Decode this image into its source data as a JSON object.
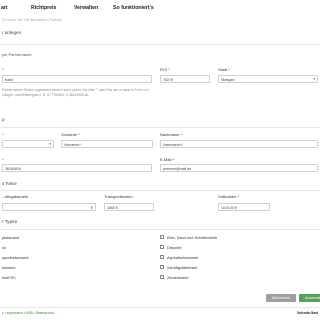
{
  "nav": {
    "items": [
      "art",
      "Richtpreis",
      "Verwalten",
      "So funktioniert's"
    ]
  },
  "subtitle": "Fu chen hier Sie Baustellen Partner",
  "sections": {
    "anlegen": "r anlegen",
    "partner_note": "ple Partnername",
    "contact": "p",
    "types": "r Typen"
  },
  "address": {
    "street_label": "*",
    "street_value": "traße",
    "plz_label": "PLZ *",
    "plz_value": "78276",
    "city_label": "Stadt *",
    "city_value": "Stuttgart",
    "help_text": "Partner keiner Straße zugeordnet werden kann, geben Sie bitte \"\" oder Pos den er kann in Form von Längen- und Breitengrad z. B. 47.7704531, 9.46419335 ab."
  },
  "contact": {
    "salutation_label": "*",
    "salutation_value": "",
    "firstname_label": "Vorname *",
    "firstname_value": "VornameV",
    "lastname_label": "Nachname *",
    "lastname_value": "NachnameV",
    "phone_label": "*",
    "phone_value": "36150816",
    "email_label": "E-Mail *",
    "email_value": "persone@mail.de",
    "tonnage_label": "o Tonne",
    "abgabe_label": "- /Abgabepreis",
    "abgabe_value": "",
    "transport_label": "Transportkosten",
    "transport_value": "1800 €",
    "vollkosten_label": "Vollkosten *",
    "vollkosten_value": "1010,00 €"
  },
  "types": {
    "left": [
      "ptstandort",
      "ck",
      "sportbetonwerk",
      "estwerk",
      "stoff RC"
    ],
    "right": [
      "Kies, Sand und Schotterwerk",
      "Deponie",
      "Asphaltmischwerk",
      "Schüttgutlieferant",
      "Zementwerk"
    ]
  },
  "buttons": {
    "cancel": "Abbrechen",
    "submit": "Anwenden"
  },
  "footer": {
    "links": "z • Impressum • AGB • Datenschutz",
    "brand": "Selenda Gast"
  },
  "colors": {
    "cancel_bg": "#9e9e9e",
    "submit_bg": "#5aa05a"
  }
}
